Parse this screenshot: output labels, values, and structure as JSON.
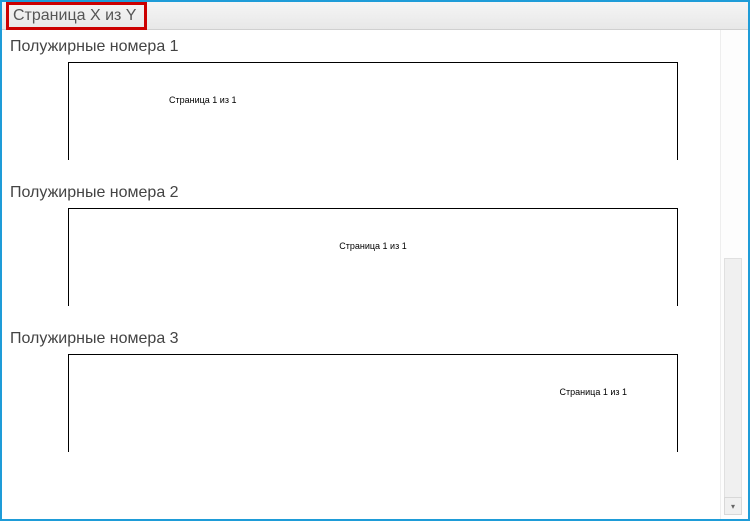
{
  "header": {
    "category_label": "Страница X из Y"
  },
  "options": [
    {
      "title": "Полужирные номера 1",
      "preview_text": "Страница 1 из 1",
      "align": "left"
    },
    {
      "title": "Полужирные номера 2",
      "preview_text": "Страница 1 из 1",
      "align": "center"
    },
    {
      "title": "Полужирные номера 3",
      "preview_text": "Страница 1 из 1",
      "align": "right"
    }
  ]
}
